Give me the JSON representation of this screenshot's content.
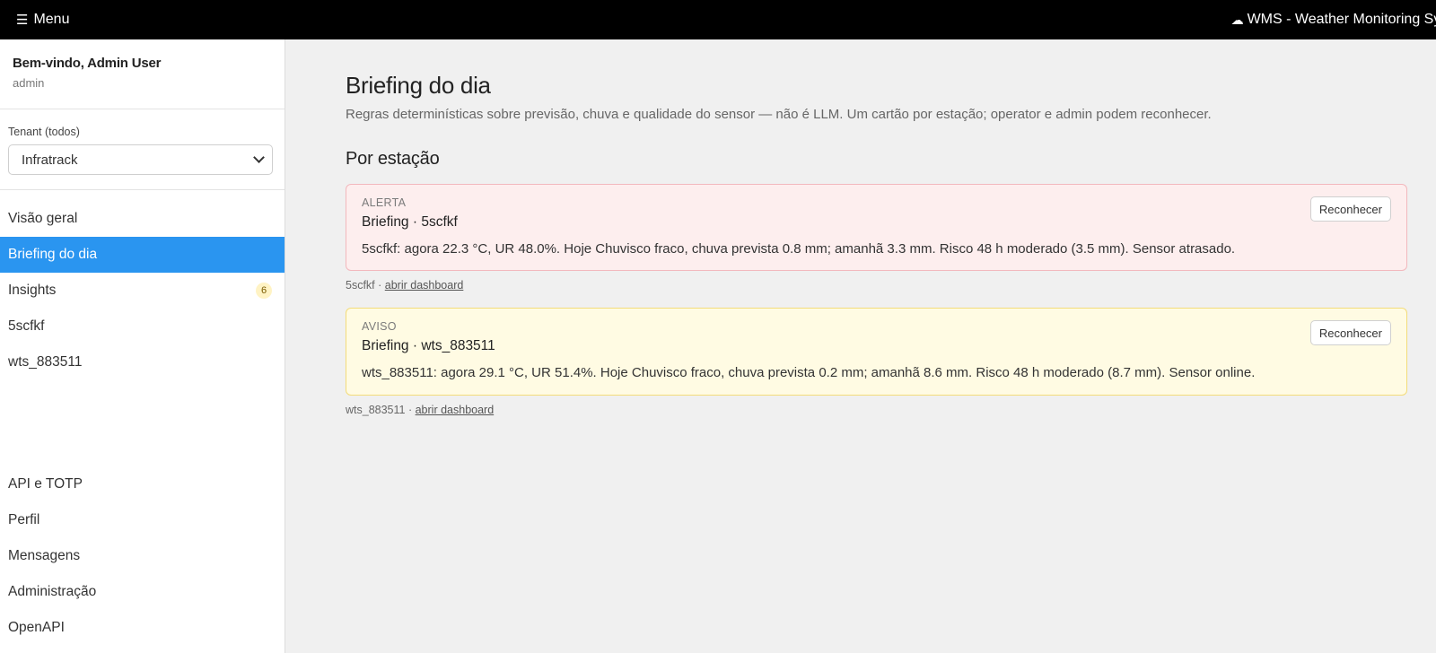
{
  "topbar": {
    "menu_icon": "☰",
    "menu_label": "Menu",
    "brand_icon": "☁",
    "brand_title": "WMS - Weather Monitoring System"
  },
  "sidebar": {
    "welcome": "Bem-vindo, Admin User",
    "role": "admin",
    "tenant_label": "Tenant (todos)",
    "tenant_value": "Infratrack",
    "items": [
      {
        "label": "Visão geral",
        "active": false
      },
      {
        "label": "Briefing do dia",
        "active": true
      },
      {
        "label": "Insights",
        "badge": "6"
      },
      {
        "label": "5scfkf"
      },
      {
        "label": "wts_883511"
      }
    ],
    "bottom_items": [
      {
        "label": "API e TOTP"
      },
      {
        "label": "Perfil"
      },
      {
        "label": "Mensagens"
      },
      {
        "label": "Administração"
      },
      {
        "label": "OpenAPI"
      }
    ]
  },
  "main": {
    "title": "Briefing do dia",
    "subtitle": "Regras determinísticas sobre previsão, chuva e qualidade do sensor — não é LLM. Um cartão por estação; operator e admin podem reconhecer.",
    "section_title": "Por estação",
    "cards": [
      {
        "level": "ALERTA",
        "title": "Briefing · 5scfkf",
        "body": "5scfkf: agora 22.3 °C, UR 48.0%. Hoje Chuvisco fraco, chuva prevista 0.8 mm; amanhã 3.3 mm. Risco 48 h moderado (3.5 mm). Sensor atrasado.",
        "ack_label": "Reconhecer",
        "footer_station": "5scfkf · ",
        "footer_link": "abrir dashboard"
      },
      {
        "level": "AVISO",
        "title": "Briefing · wts_883511",
        "body": "wts_883511: agora 29.1 °C, UR 51.4%. Hoje Chuvisco fraco, chuva prevista 0.2 mm; amanhã 8.6 mm. Risco 48 h moderado (8.7 mm). Sensor online.",
        "ack_label": "Reconhecer",
        "footer_station": "wts_883511 · ",
        "footer_link": "abrir dashboard"
      }
    ]
  },
  "colors": {
    "active_nav": "#2a95f0",
    "alert_bg": "#fdeeee",
    "alert_border": "#f2b8bd",
    "warn_bg": "#fffbe3",
    "warn_border": "#f3dc7a"
  }
}
